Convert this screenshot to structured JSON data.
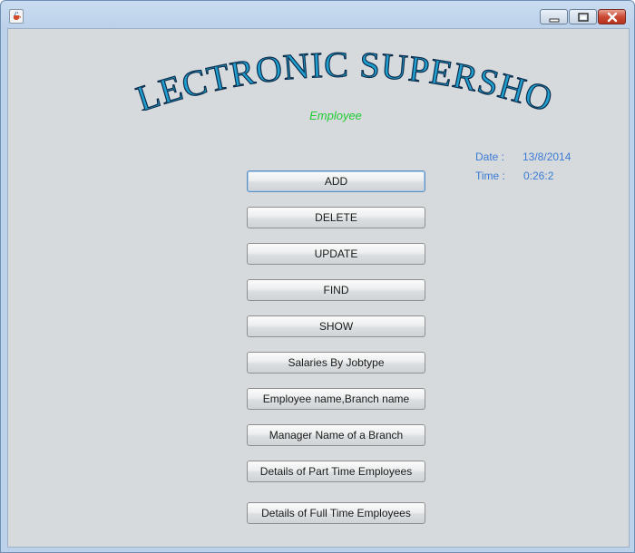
{
  "window": {
    "app_icon": "java-cup-icon",
    "controls": [
      "minimize-icon",
      "maximize-icon",
      "close-icon"
    ]
  },
  "header": {
    "title": "ELECTRONIC SUPERSHOP",
    "subtitle": "Employee",
    "title_color": "#1f9fd0",
    "subtitle_color": "#22cc33"
  },
  "info": {
    "date_label": "Date :",
    "date_value": "13/8/2014",
    "time_label": "Time :",
    "time_value": "0:26:2",
    "color": "#3b7bd3"
  },
  "buttons": {
    "add": "ADD",
    "delete": "DELETE",
    "update": "UPDATE",
    "find": "FIND",
    "show": "SHOW",
    "salaries": "Salaries By Jobtype",
    "employee_branch": "Employee name,Branch name",
    "manager_branch": "Manager Name of a Branch",
    "part_time": "Details of Part Time Employees",
    "full_time": "Details of Full Time Employees"
  }
}
